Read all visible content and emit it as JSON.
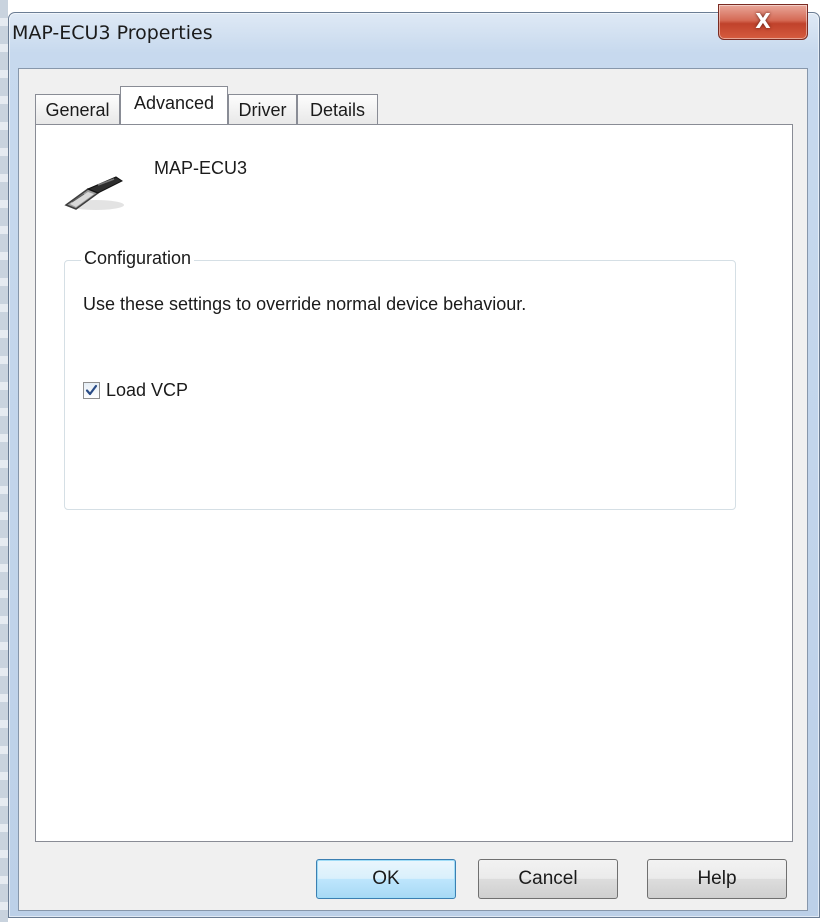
{
  "window": {
    "title": "MAP-ECU3 Properties",
    "close_glyph": "X"
  },
  "tabs": [
    {
      "label": "General",
      "active": false
    },
    {
      "label": "Advanced",
      "active": true
    },
    {
      "label": "Driver",
      "active": false
    },
    {
      "label": "Details",
      "active": false
    }
  ],
  "device": {
    "name": "MAP-ECU3",
    "icon": "usb-device-icon"
  },
  "configuration": {
    "legend": "Configuration",
    "description": "Use these settings to override normal device behaviour.",
    "load_vcp": {
      "label": "Load VCP",
      "checked": true
    }
  },
  "buttons": {
    "ok": "OK",
    "cancel": "Cancel",
    "help": "Help"
  },
  "colors": {
    "titlebar": "#c7d9ee",
    "close_button": "#c0422b",
    "default_button": "#bee6fd",
    "checkmark": "#2a4c86"
  }
}
